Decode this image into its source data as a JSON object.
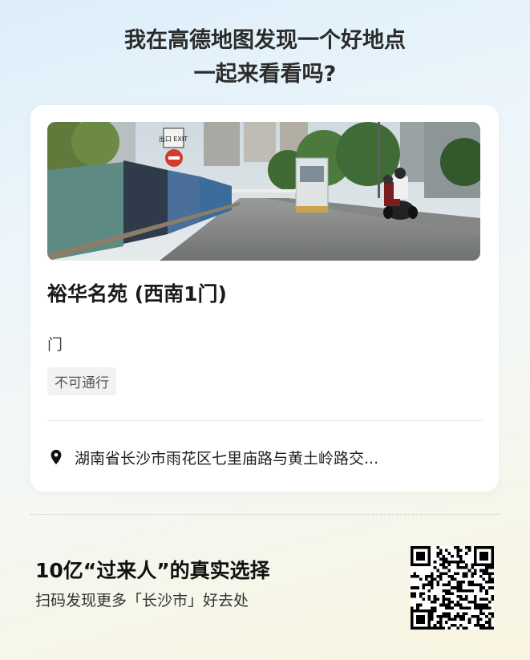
{
  "headline": {
    "line1": "我在高德地图发现一个好地点",
    "line2": "一起来看看吗?"
  },
  "card": {
    "place_name": "裕华名苑 (西南1门)",
    "category": "门",
    "status_badge": "不可通行",
    "address": "湖南省长沙市雨花区七里庙路与黄土岭路交...",
    "photo_signs": {
      "exit": "出口 EXIT"
    }
  },
  "footer": {
    "slogan": "10亿“过来人”的真实选择",
    "scan_text": "扫码发现更多「长沙市」好去处"
  },
  "icons": {
    "address": "location-pin-icon",
    "qr": "qr-code"
  }
}
